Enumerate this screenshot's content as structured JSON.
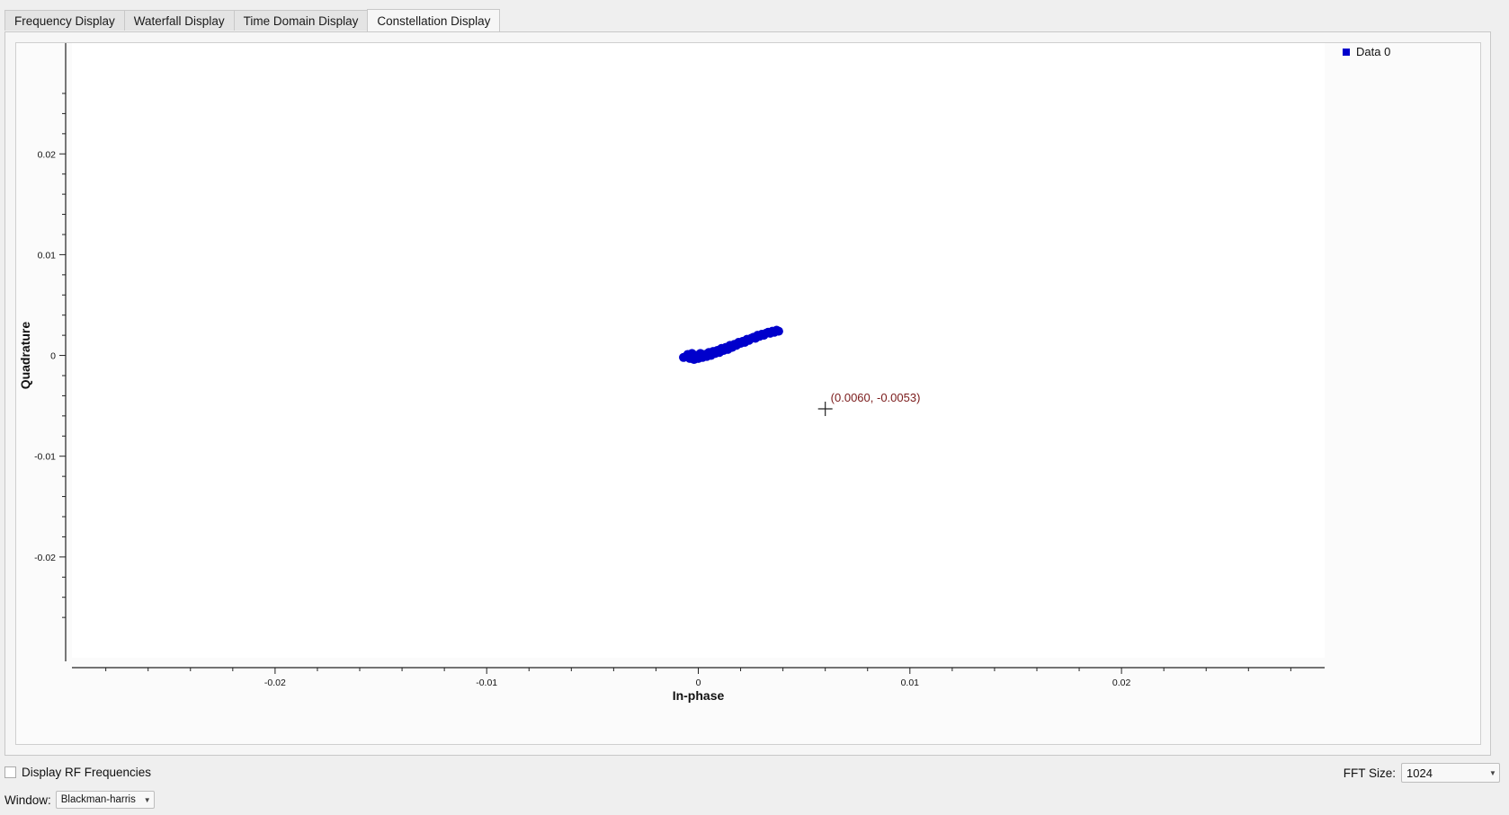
{
  "tabs": [
    {
      "label": "Frequency Display"
    },
    {
      "label": "Waterfall Display"
    },
    {
      "label": "Time Domain Display"
    },
    {
      "label": "Constellation Display"
    }
  ],
  "active_tab": "Constellation Display",
  "controls": {
    "rf_checkbox_label": "Display RF Frequencies",
    "rf_checked": false,
    "fft_label": "FFT Size:",
    "fft_value": "1024",
    "window_label": "Window:",
    "window_value": "Blackman-harris"
  },
  "chart_data": {
    "type": "scatter",
    "xlabel": "In-phase",
    "ylabel": "Quadrature",
    "xlim": [
      -0.0296,
      0.0296
    ],
    "ylim": [
      -0.03,
      0.0301
    ],
    "xticks": [
      {
        "value": -0.02,
        "label": "-0.02"
      },
      {
        "value": -0.01,
        "label": "-0.01"
      },
      {
        "value": 0,
        "label": "0"
      },
      {
        "value": 0.01,
        "label": "0.01"
      },
      {
        "value": 0.02,
        "label": "0.02"
      }
    ],
    "yticks": [
      {
        "value": 0.02,
        "label": "0.02"
      },
      {
        "value": 0.01,
        "label": "0.01"
      },
      {
        "value": 0,
        "label": "0"
      },
      {
        "value": -0.01,
        "label": "-0.01"
      },
      {
        "value": -0.02,
        "label": "-0.02"
      }
    ],
    "legend": {
      "placement": "top-right",
      "entries": [
        {
          "name": "Data 0",
          "color": "#0000cc"
        }
      ]
    },
    "series": [
      {
        "name": "Data 0",
        "color": "#0000cc",
        "points": [
          [
            -0.0007,
            -0.0002
          ],
          [
            -0.0005,
            0.0001
          ],
          [
            -0.0004,
            -0.0003
          ],
          [
            -0.0003,
            0.0002
          ],
          [
            -0.0002,
            -0.0004
          ],
          [
            -0.0001,
            0.0
          ],
          [
            0.0,
            -0.0003
          ],
          [
            0.0001,
            0.0002
          ],
          [
            0.0002,
            -0.0002
          ],
          [
            0.0003,
            0.0001
          ],
          [
            0.0004,
            -0.0001
          ],
          [
            0.0005,
            0.0003
          ],
          [
            0.0006,
            0.0
          ],
          [
            0.0007,
            0.0004
          ],
          [
            0.0008,
            0.0002
          ],
          [
            0.0009,
            0.0005
          ],
          [
            0.001,
            0.0003
          ],
          [
            0.0011,
            0.0007
          ],
          [
            0.0012,
            0.0005
          ],
          [
            0.0013,
            0.0008
          ],
          [
            0.0014,
            0.0006
          ],
          [
            0.0015,
            0.001
          ],
          [
            0.0016,
            0.0008
          ],
          [
            0.0017,
            0.0011
          ],
          [
            0.0018,
            0.001
          ],
          [
            0.0019,
            0.0013
          ],
          [
            0.002,
            0.0012
          ],
          [
            0.0021,
            0.0014
          ],
          [
            0.0022,
            0.0013
          ],
          [
            0.0023,
            0.0016
          ],
          [
            0.0024,
            0.0015
          ],
          [
            0.0025,
            0.0017
          ],
          [
            0.0026,
            0.0018
          ],
          [
            0.0027,
            0.0017
          ],
          [
            0.0028,
            0.002
          ],
          [
            0.0029,
            0.0019
          ],
          [
            0.003,
            0.0021
          ],
          [
            0.0031,
            0.002
          ],
          [
            0.0032,
            0.0022
          ],
          [
            0.0033,
            0.0023
          ],
          [
            0.0034,
            0.0022
          ],
          [
            0.0035,
            0.0024
          ],
          [
            0.0036,
            0.0023
          ],
          [
            0.0037,
            0.0025
          ],
          [
            0.0038,
            0.0024
          ]
        ]
      }
    ],
    "cursor_readout": {
      "label": "(0.0060, -0.0053)",
      "x": 0.006,
      "y": -0.0053
    }
  }
}
